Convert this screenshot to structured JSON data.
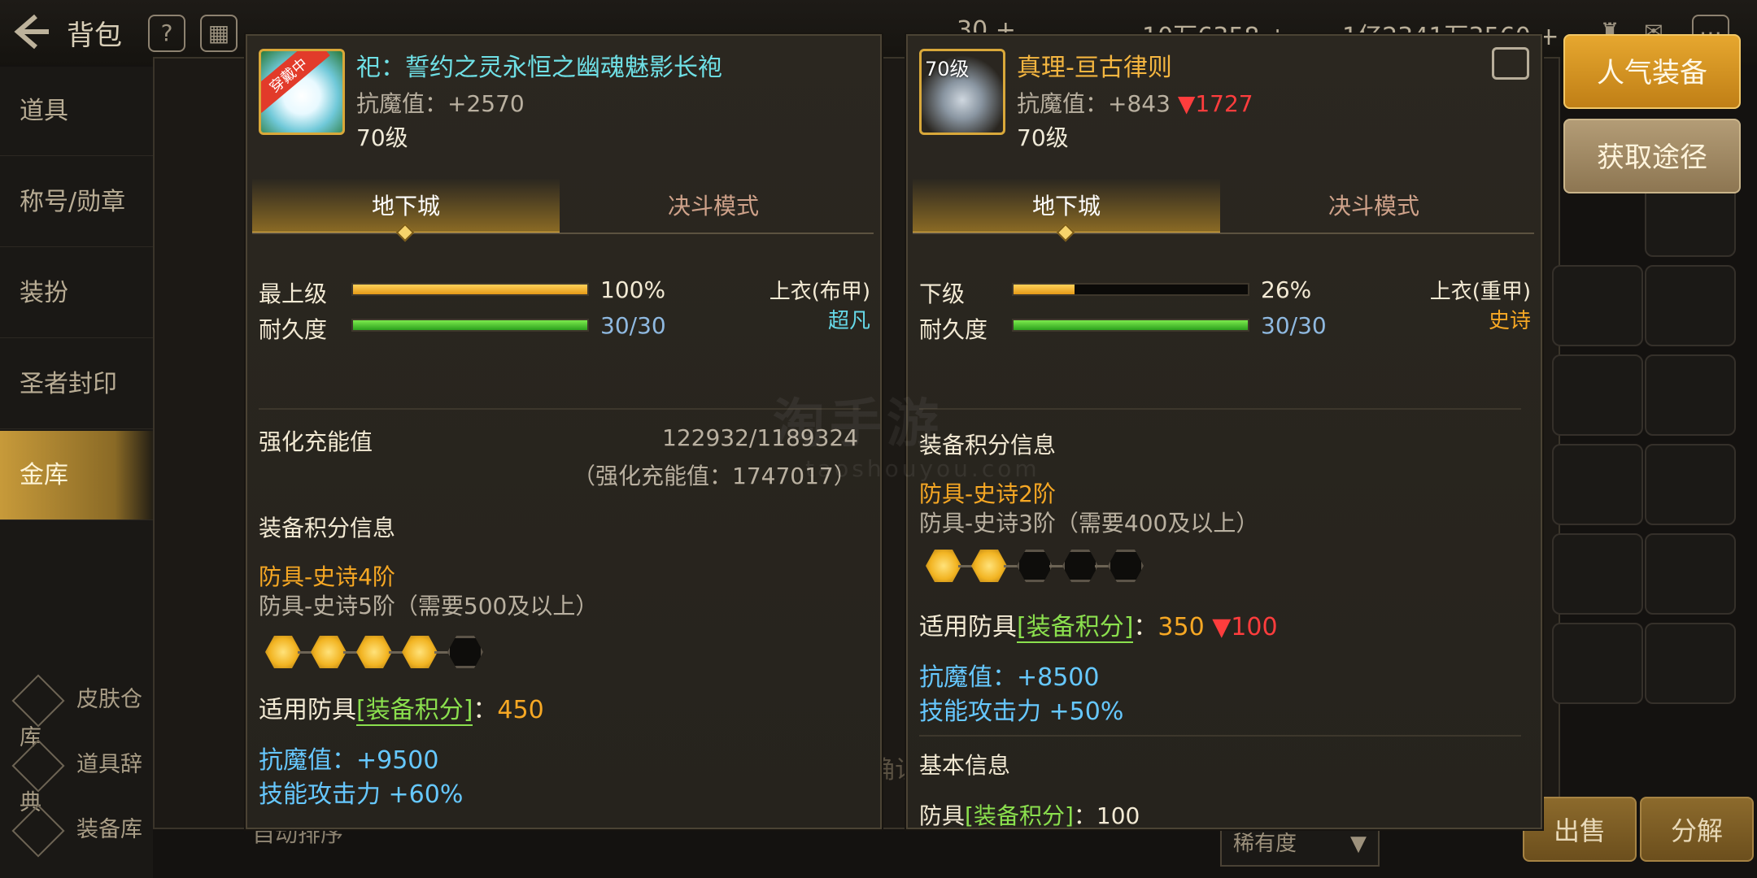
{
  "topbar": {
    "bag_title": "背包",
    "help_icon": "?",
    "currency_1": "30 +",
    "currency_2": "10万6358 +",
    "currency_3": "1亿2341万3560 +"
  },
  "sidebar": {
    "items": [
      {
        "label": "道具"
      },
      {
        "label": "称号/勋章"
      },
      {
        "label": "装扮"
      },
      {
        "label": "圣者封印"
      },
      {
        "label": "金库"
      }
    ],
    "bottom": [
      {
        "label": "皮肤仓库"
      },
      {
        "label": "道具辞典"
      },
      {
        "label": "装备库"
      }
    ]
  },
  "background": {
    "auto_sort": "自动排序",
    "sort_select": "稀有度",
    "sell_button": "出售",
    "decompose_button": "分解",
    "ghost_confirm": "确认"
  },
  "actions": {
    "popular_button": "人气装备",
    "source_button": "获取途径"
  },
  "left_item": {
    "badge": "穿戴中",
    "name": "祀：誓约之灵永恒之幽魂魅影长袍",
    "stat": "抗魔值：+2570",
    "level": "70级",
    "tabs": [
      "地下城",
      "决斗模式"
    ],
    "grade_label": "最上级",
    "grade_pct": "100%",
    "grade_value": 1.0,
    "durability_label": "耐久度",
    "durability": "30/30",
    "durability_value": 1.0,
    "slot": "上衣(布甲)",
    "rarity": "超凡",
    "charge_label": "强化充能值",
    "charge_value": "122932/1189324",
    "charge_total": "（强化充能值：1747017）",
    "score_title": "装备积分信息",
    "tier_current": "防具-史诗4阶",
    "tier_next": "防具-史诗5阶（需要500及以上）",
    "tier_filled": 4,
    "tier_total": 5,
    "score_prefix": "适用防具",
    "score_tag": "[装备积分]",
    "score_colon": "：",
    "score_value": "450",
    "bonus_1": "抗魔值：+9500",
    "bonus_2": "技能攻击力 +60%"
  },
  "right_item": {
    "level_badge": "70级",
    "name": "真理-亘古律则",
    "stat": "抗魔值：+843",
    "stat_diff": "▼1727",
    "level": "70级",
    "tabs": [
      "地下城",
      "决斗模式"
    ],
    "grade_label": "下级",
    "grade_pct": "26%",
    "grade_value": 0.26,
    "durability_label": "耐久度",
    "durability": "30/30",
    "durability_value": 1.0,
    "slot": "上衣(重甲)",
    "rarity": "史诗",
    "score_title": "装备积分信息",
    "tier_current": "防具-史诗2阶",
    "tier_next": "防具-史诗3阶（需要400及以上）",
    "tier_filled": 2,
    "tier_total": 5,
    "score_prefix": "适用防具",
    "score_tag": "[装备积分]",
    "score_colon": "：",
    "score_value": "350",
    "score_diff": "▼100",
    "bonus_1": "抗魔值：+8500",
    "bonus_2": "技能攻击力 +50%",
    "basic_title": "基本信息",
    "basic_prefix": "防具",
    "basic_tag": "[装备积分]",
    "basic_value": "：100"
  },
  "watermark": {
    "main": "淘手游",
    "sub": "taoshouyou.com"
  },
  "colors": {
    "gold_accent": "#f7a824",
    "cyan_name": "#6fe0e6",
    "bonus_blue": "#66c8ff",
    "down_red": "#ff3d3d",
    "score_green": "#8be04e"
  }
}
